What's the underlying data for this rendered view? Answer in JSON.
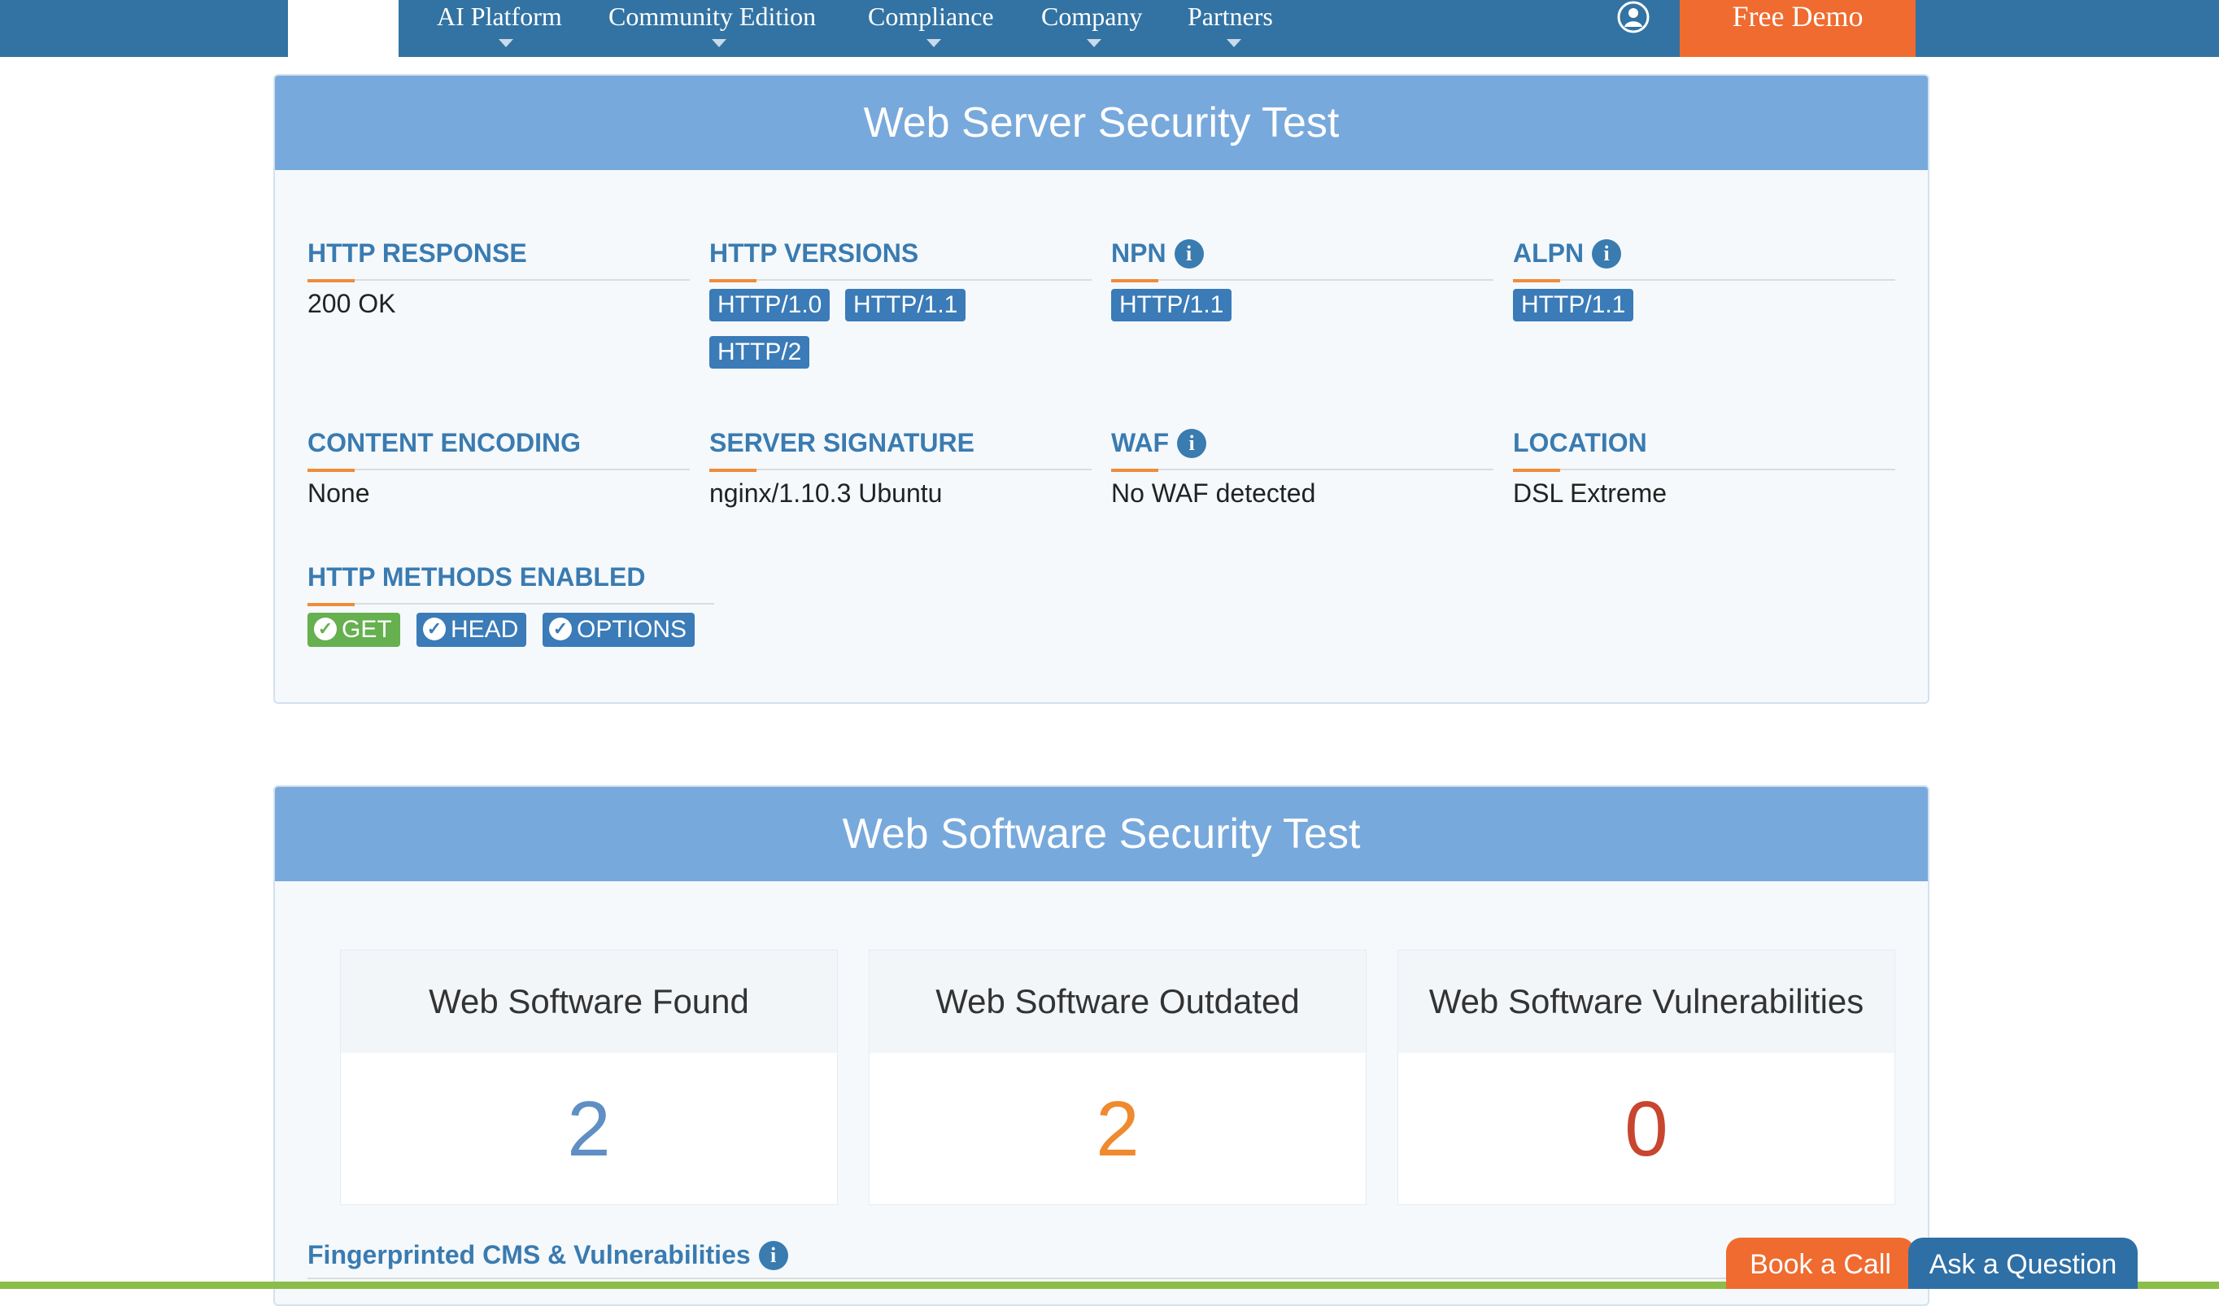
{
  "nav": {
    "items": [
      {
        "label": "AI Platform"
      },
      {
        "label": "Community Edition"
      },
      {
        "label": "Compliance"
      },
      {
        "label": "Company"
      },
      {
        "label": "Partners"
      }
    ],
    "user_icon": "user-circle-icon",
    "cta_label": "Free Demo"
  },
  "server_test": {
    "title": "Web Server Security Test",
    "fields": {
      "http_response": {
        "title": "HTTP RESPONSE",
        "value": "200 OK"
      },
      "http_versions": {
        "title": "HTTP VERSIONS",
        "tags": [
          "HTTP/1.0",
          "HTTP/1.1",
          "HTTP/2"
        ]
      },
      "npn": {
        "title": "NPN",
        "tags": [
          "HTTP/1.1"
        ]
      },
      "alpn": {
        "title": "ALPN",
        "tags": [
          "HTTP/1.1"
        ]
      },
      "content_encoding": {
        "title": "CONTENT ENCODING",
        "value": "None"
      },
      "server_signature": {
        "title": "SERVER SIGNATURE",
        "value": "nginx/1.10.3 Ubuntu"
      },
      "waf": {
        "title": "WAF",
        "value": "No WAF detected"
      },
      "location": {
        "title": "LOCATION",
        "value": "DSL Extreme"
      },
      "http_methods": {
        "title": "HTTP METHODS ENABLED",
        "methods": [
          "GET",
          "HEAD",
          "OPTIONS"
        ]
      }
    },
    "info_glyph": "i"
  },
  "software_test": {
    "title": "Web Software Security Test",
    "stats": [
      {
        "label": "Web Software Found",
        "value": "2",
        "color": "#5f8fc4"
      },
      {
        "label": "Web Software Outdated",
        "value": "2",
        "color": "#ef8a2f"
      },
      {
        "label": "Web Software Vulnerabilities",
        "value": "0",
        "color": "#c8452f"
      }
    ],
    "fingerprint_title": "Fingerprinted CMS & Vulnerabilities"
  },
  "floating": {
    "book_call": "Book a Call",
    "ask_question": "Ask a Question"
  },
  "colors": {
    "nav_bg": "#3273a3",
    "cta": "#ef6b2f",
    "panel_header": "#78a9dc",
    "accent_orange": "#ef8c3a",
    "tag_blue": "#3a7bb8",
    "method_green": "#66b04f"
  }
}
